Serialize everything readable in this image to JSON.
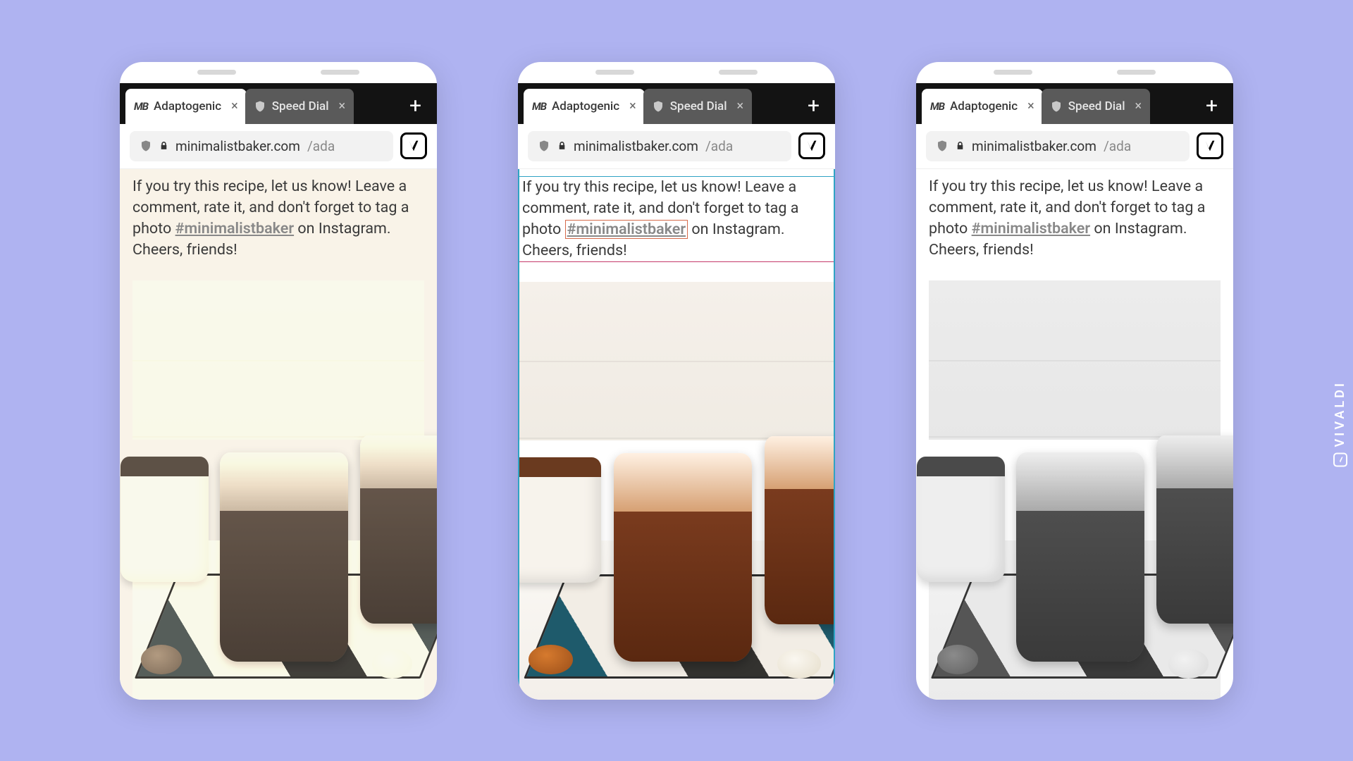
{
  "tabs": {
    "active_label": "Adaptogenic",
    "inactive_label": "Speed Dial"
  },
  "url": {
    "domain": "minimalistbaker.com",
    "path": "/ada"
  },
  "content": {
    "text_before": "If you try this recipe, let us know! Leave a comment, rate it, and don't forget to tag a photo ",
    "hashtag": "#minimalistbaker",
    "text_after": " on Instagram. Cheers, friends!"
  },
  "watermark": "VIVALDI"
}
